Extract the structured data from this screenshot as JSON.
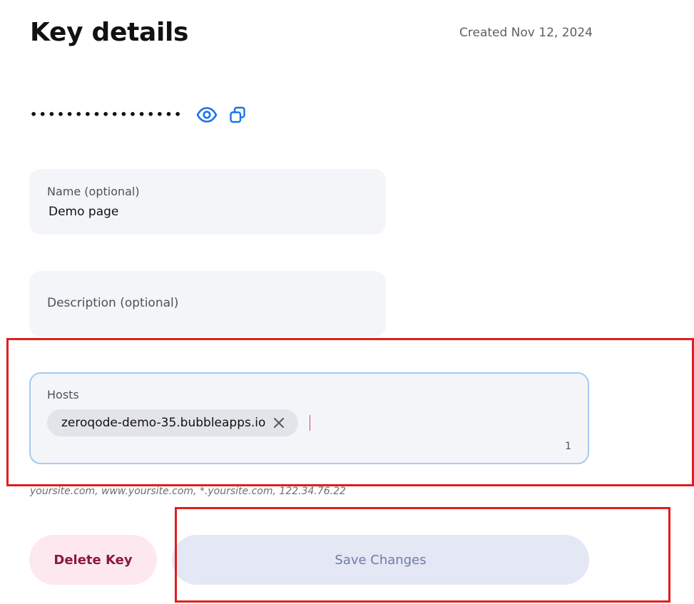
{
  "header": {
    "title": "Key details",
    "created": "Created Nov 12, 2024"
  },
  "key": {
    "masked": "•••••••••••••••••"
  },
  "icons": {
    "reveal": "eye-icon",
    "copy": "copy-icon",
    "remove_host": "close-icon"
  },
  "form": {
    "name": {
      "label": "Name (optional)",
      "value": "Demo page"
    },
    "description": {
      "label": "Description (optional)",
      "value": ""
    },
    "hosts": {
      "label": "Hosts",
      "items": [
        "zeroqode-demo-35.bubbleapps.io"
      ],
      "count": "1",
      "hint": "yoursite.com, www.yoursite.com, *.yoursite.com, 122.34.76.22"
    }
  },
  "actions": {
    "delete_label": "Delete Key",
    "save_label": "Save Changes"
  },
  "colors": {
    "accent": "#1a73e8",
    "field_bg": "#f4f5f9",
    "focus_border": "#a6cbf2",
    "delete_bg": "#fde8ef",
    "delete_text": "#8c1743",
    "save_bg": "#e4e8f5",
    "save_text": "#6f7aa8",
    "highlight": "#e01e1e"
  }
}
